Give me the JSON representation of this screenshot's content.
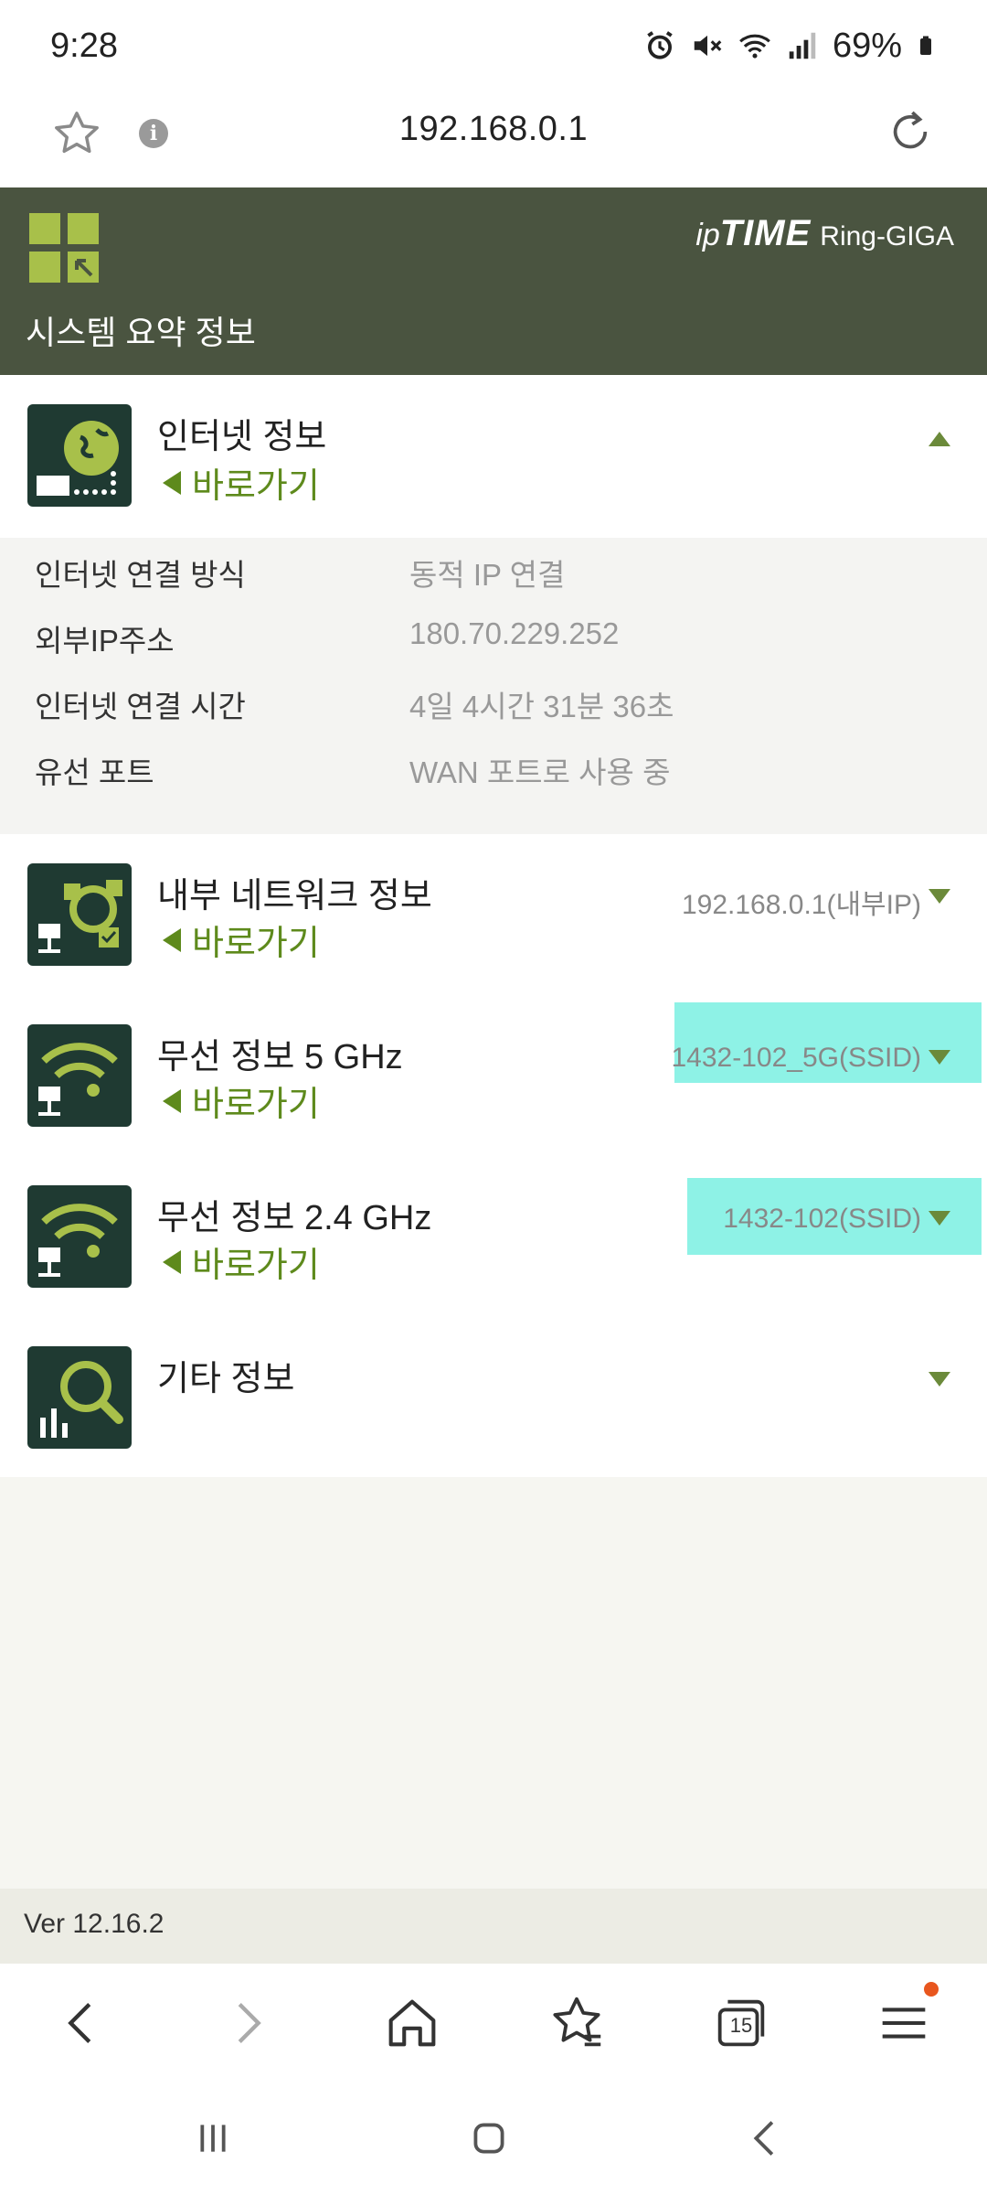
{
  "status_bar": {
    "time": "9:28",
    "battery": "69%"
  },
  "url_bar": {
    "url": "192.168.0.1"
  },
  "header": {
    "brand_ip": "ip",
    "brand_time": "TIME",
    "brand_model": "Ring-GIGA",
    "title": "시스템 요약 정보"
  },
  "sections": {
    "internet": {
      "title": "인터넷 정보",
      "link": "바로가기"
    },
    "lan": {
      "title": "내부 네트워크 정보",
      "link": "바로가기",
      "value": "192.168.0.1(내부IP)"
    },
    "wifi5": {
      "title": "무선 정보 5 GHz",
      "link": "바로가기",
      "value": "1432-102_5G(SSID)"
    },
    "wifi24": {
      "title": "무선 정보 2.4 GHz",
      "link": "바로가기",
      "value": "1432-102(SSID)"
    },
    "etc": {
      "title": "기타 정보"
    }
  },
  "internet_details": [
    {
      "label": "인터넷 연결 방식",
      "value": "동적 IP 연결"
    },
    {
      "label": "외부IP주소",
      "value": "180.70.229.252"
    },
    {
      "label": "인터넷 연결 시간",
      "value": "4일 4시간 31분 36초"
    },
    {
      "label": "유선 포트",
      "value": "WAN 포트로 사용 중"
    }
  ],
  "footer": {
    "version": "Ver 12.16.2"
  },
  "toolbar": {
    "tab_count": "15"
  },
  "colors": {
    "header_bg": "#4a5440",
    "accent_green": "#5e8a1c",
    "icon_bg": "#1f3a32",
    "highlight": "#8ef2e6"
  }
}
